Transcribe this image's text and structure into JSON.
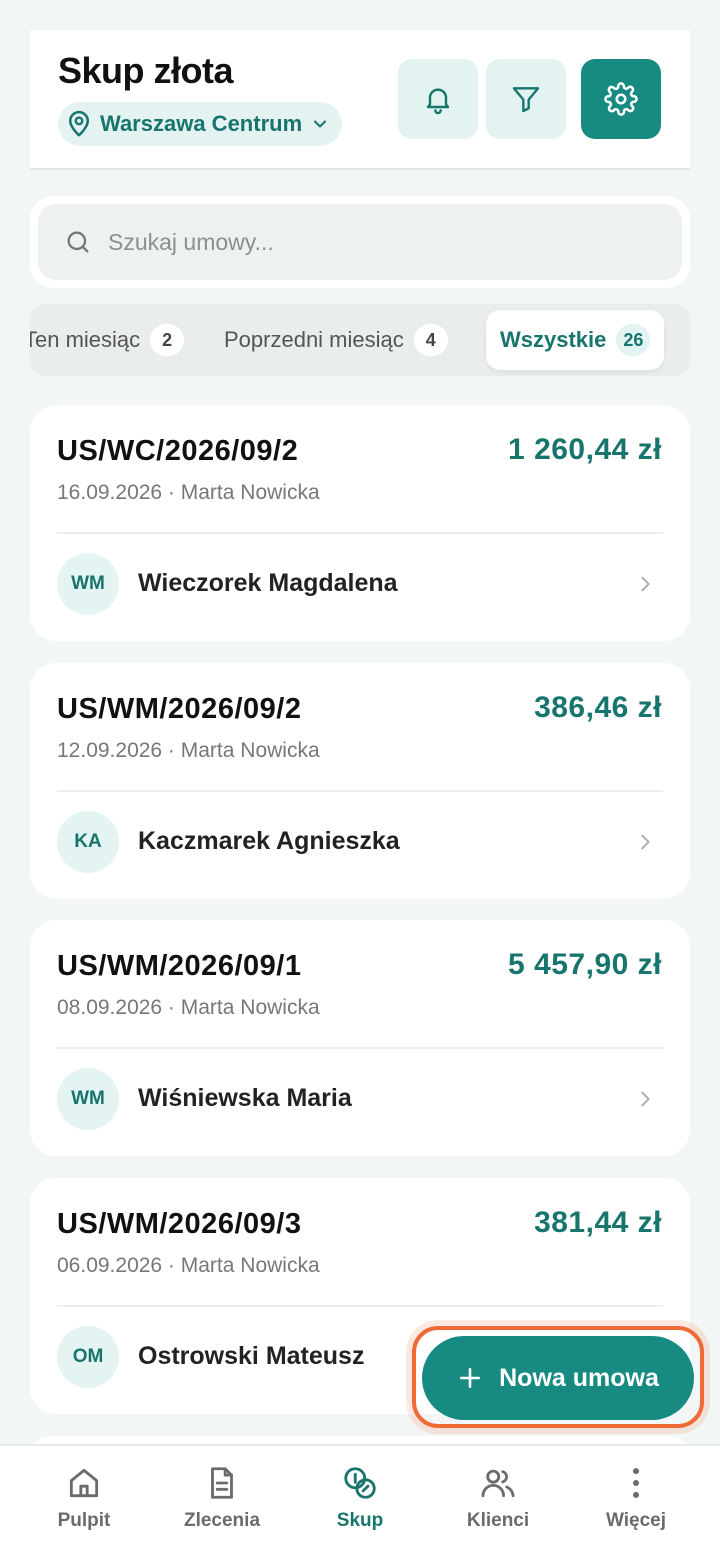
{
  "colors": {
    "accent": "#178b82",
    "accent_light": "#e2f3f1",
    "highlight": "#ef6a34"
  },
  "header": {
    "title": "Skup złota",
    "location": "Warszawa Centrum",
    "icons": [
      "bell-icon",
      "filter-icon",
      "gear-icon"
    ]
  },
  "search": {
    "placeholder": "Szukaj umowy..."
  },
  "tabs": [
    {
      "label": "Ten miesiąc",
      "count": "2"
    },
    {
      "label": "Poprzedni miesiąc",
      "count": "4"
    },
    {
      "label": "Wszystkie",
      "count": "26",
      "active": true
    }
  ],
  "contracts": [
    {
      "number": "US/WC/2026/09/2",
      "amount": "1 260,44 zł",
      "meta": "16.09.2026 · Marta Nowicka",
      "initials": "WM",
      "client": "Wieczorek Magdalena"
    },
    {
      "number": "US/WM/2026/09/2",
      "amount": "386,46 zł",
      "meta": "12.09.2026 · Marta Nowicka",
      "initials": "KA",
      "client": "Kaczmarek Agnieszka"
    },
    {
      "number": "US/WM/2026/09/1",
      "amount": "5 457,90 zł",
      "meta": "08.09.2026 · Marta Nowicka",
      "initials": "WM",
      "client": "Wiśniewska Maria"
    },
    {
      "number": "US/WM/2026/09/3",
      "amount": "381,44 zł",
      "meta": "06.09.2026 · Marta Nowicka",
      "initials": "OM",
      "client": "Ostrowski Mateusz"
    }
  ],
  "fab": {
    "label": "Nowa umowa"
  },
  "nav": [
    {
      "label": "Pulpit",
      "icon": "home-icon"
    },
    {
      "label": "Zlecenia",
      "icon": "document-icon"
    },
    {
      "label": "Skup",
      "icon": "coins-icon",
      "active": true
    },
    {
      "label": "Klienci",
      "icon": "users-icon"
    },
    {
      "label": "Więcej",
      "icon": "more-icon"
    }
  ]
}
